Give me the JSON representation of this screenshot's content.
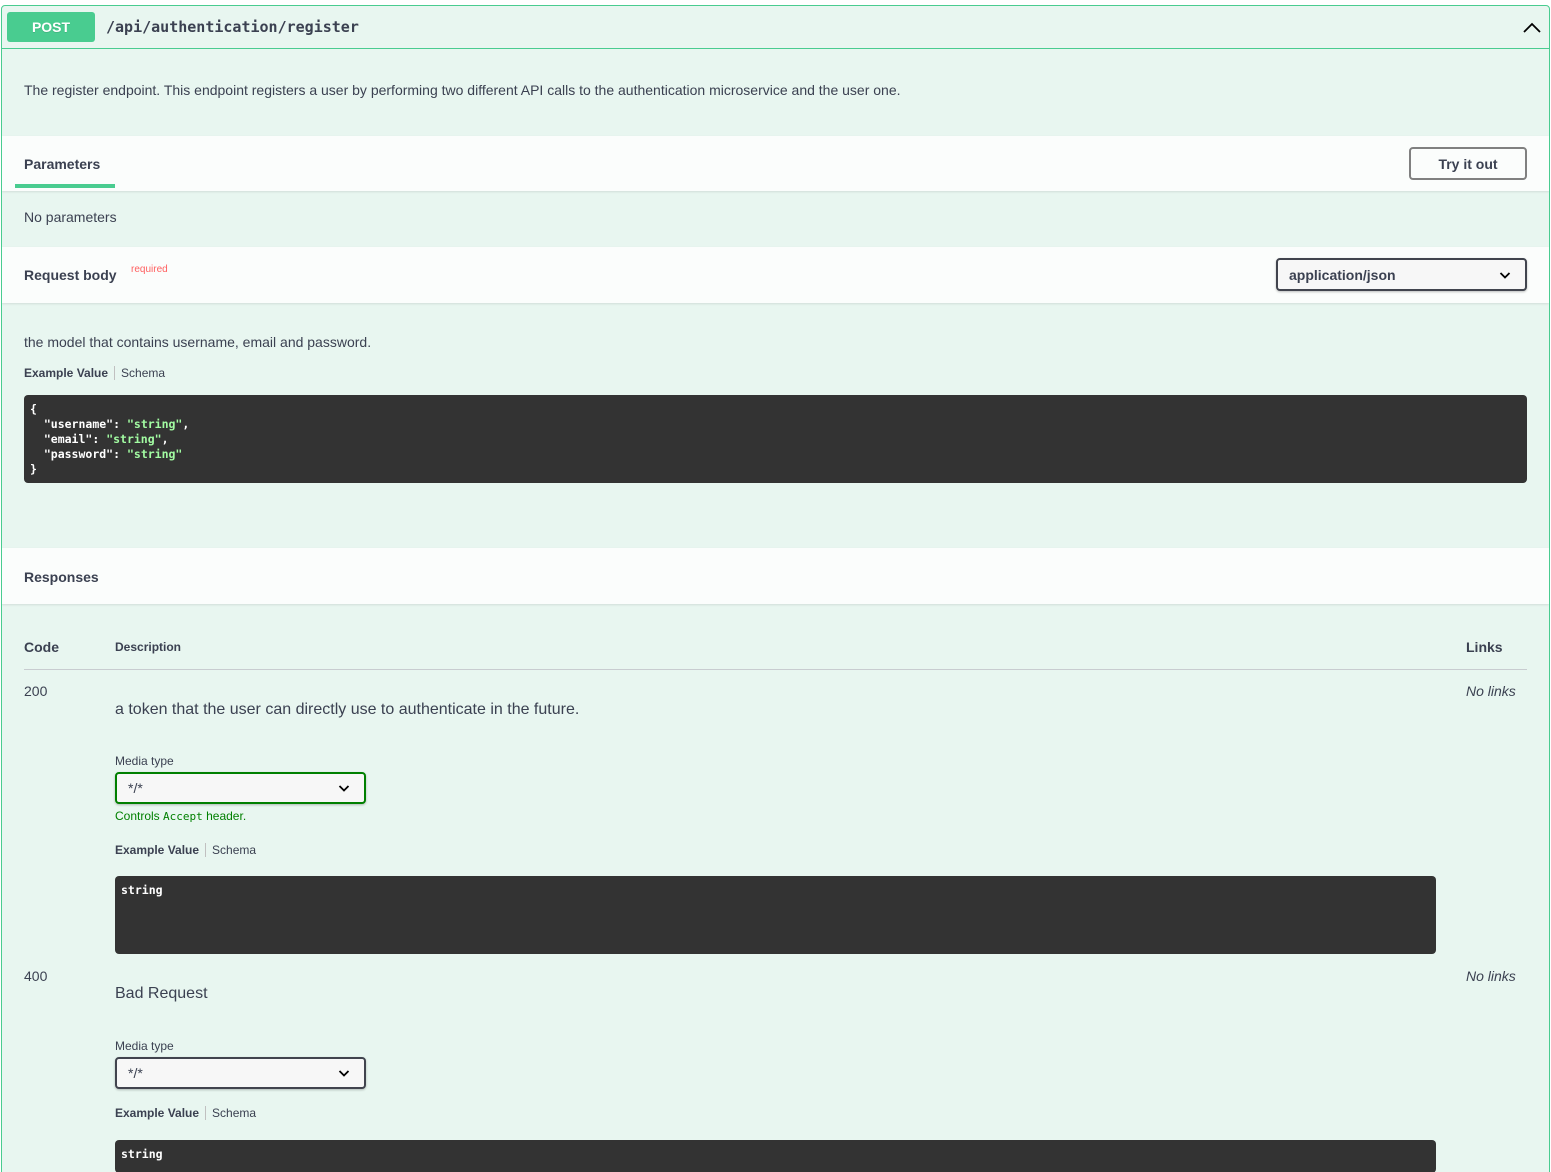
{
  "operation": {
    "method": "POST",
    "path": "/api/authentication/register",
    "description": "The register endpoint. This endpoint registers a user by performing two different API calls to the authentication microservice and the user one."
  },
  "parameters": {
    "title": "Parameters",
    "try_label": "Try it out",
    "empty_text": "No parameters"
  },
  "request_body": {
    "title": "Request body",
    "required_label": "required",
    "content_type": "application/json",
    "description": "the model that contains username, email and password.",
    "tab_example": "Example Value",
    "tab_schema": "Schema",
    "example": {
      "open": "{",
      "username_key": "\"username\"",
      "username_val": "\"string\"",
      "email_key": "\"email\"",
      "email_val": "\"string\"",
      "password_key": "\"password\"",
      "password_val": "\"string\"",
      "close": "}"
    }
  },
  "responses": {
    "title": "Responses",
    "col_code": "Code",
    "col_description": "Description",
    "col_links": "Links",
    "rows": [
      {
        "code": "200",
        "description": "a token that the user can directly use to authenticate in the future.",
        "media_label": "Media type",
        "media_value": "*/*",
        "note_prefix": "Controls ",
        "note_code": "Accept",
        "note_suffix": " header.",
        "tab_example": "Example Value",
        "tab_schema": "Schema",
        "example": "string",
        "links": "No links"
      },
      {
        "code": "400",
        "description": "Bad Request",
        "media_label": "Media type",
        "media_value": "*/*",
        "tab_example": "Example Value",
        "tab_schema": "Schema",
        "example": "string",
        "links": "No links"
      }
    ]
  },
  "colors": {
    "accent": "#49cc90",
    "background": "#e8f6f0",
    "code_background": "#333333",
    "string_color": "#a2fca2",
    "required": "#ff6060",
    "note_green": "#008000"
  },
  "icons": {
    "collapse": "chevron-up-icon",
    "select": "chevron-down-icon"
  }
}
